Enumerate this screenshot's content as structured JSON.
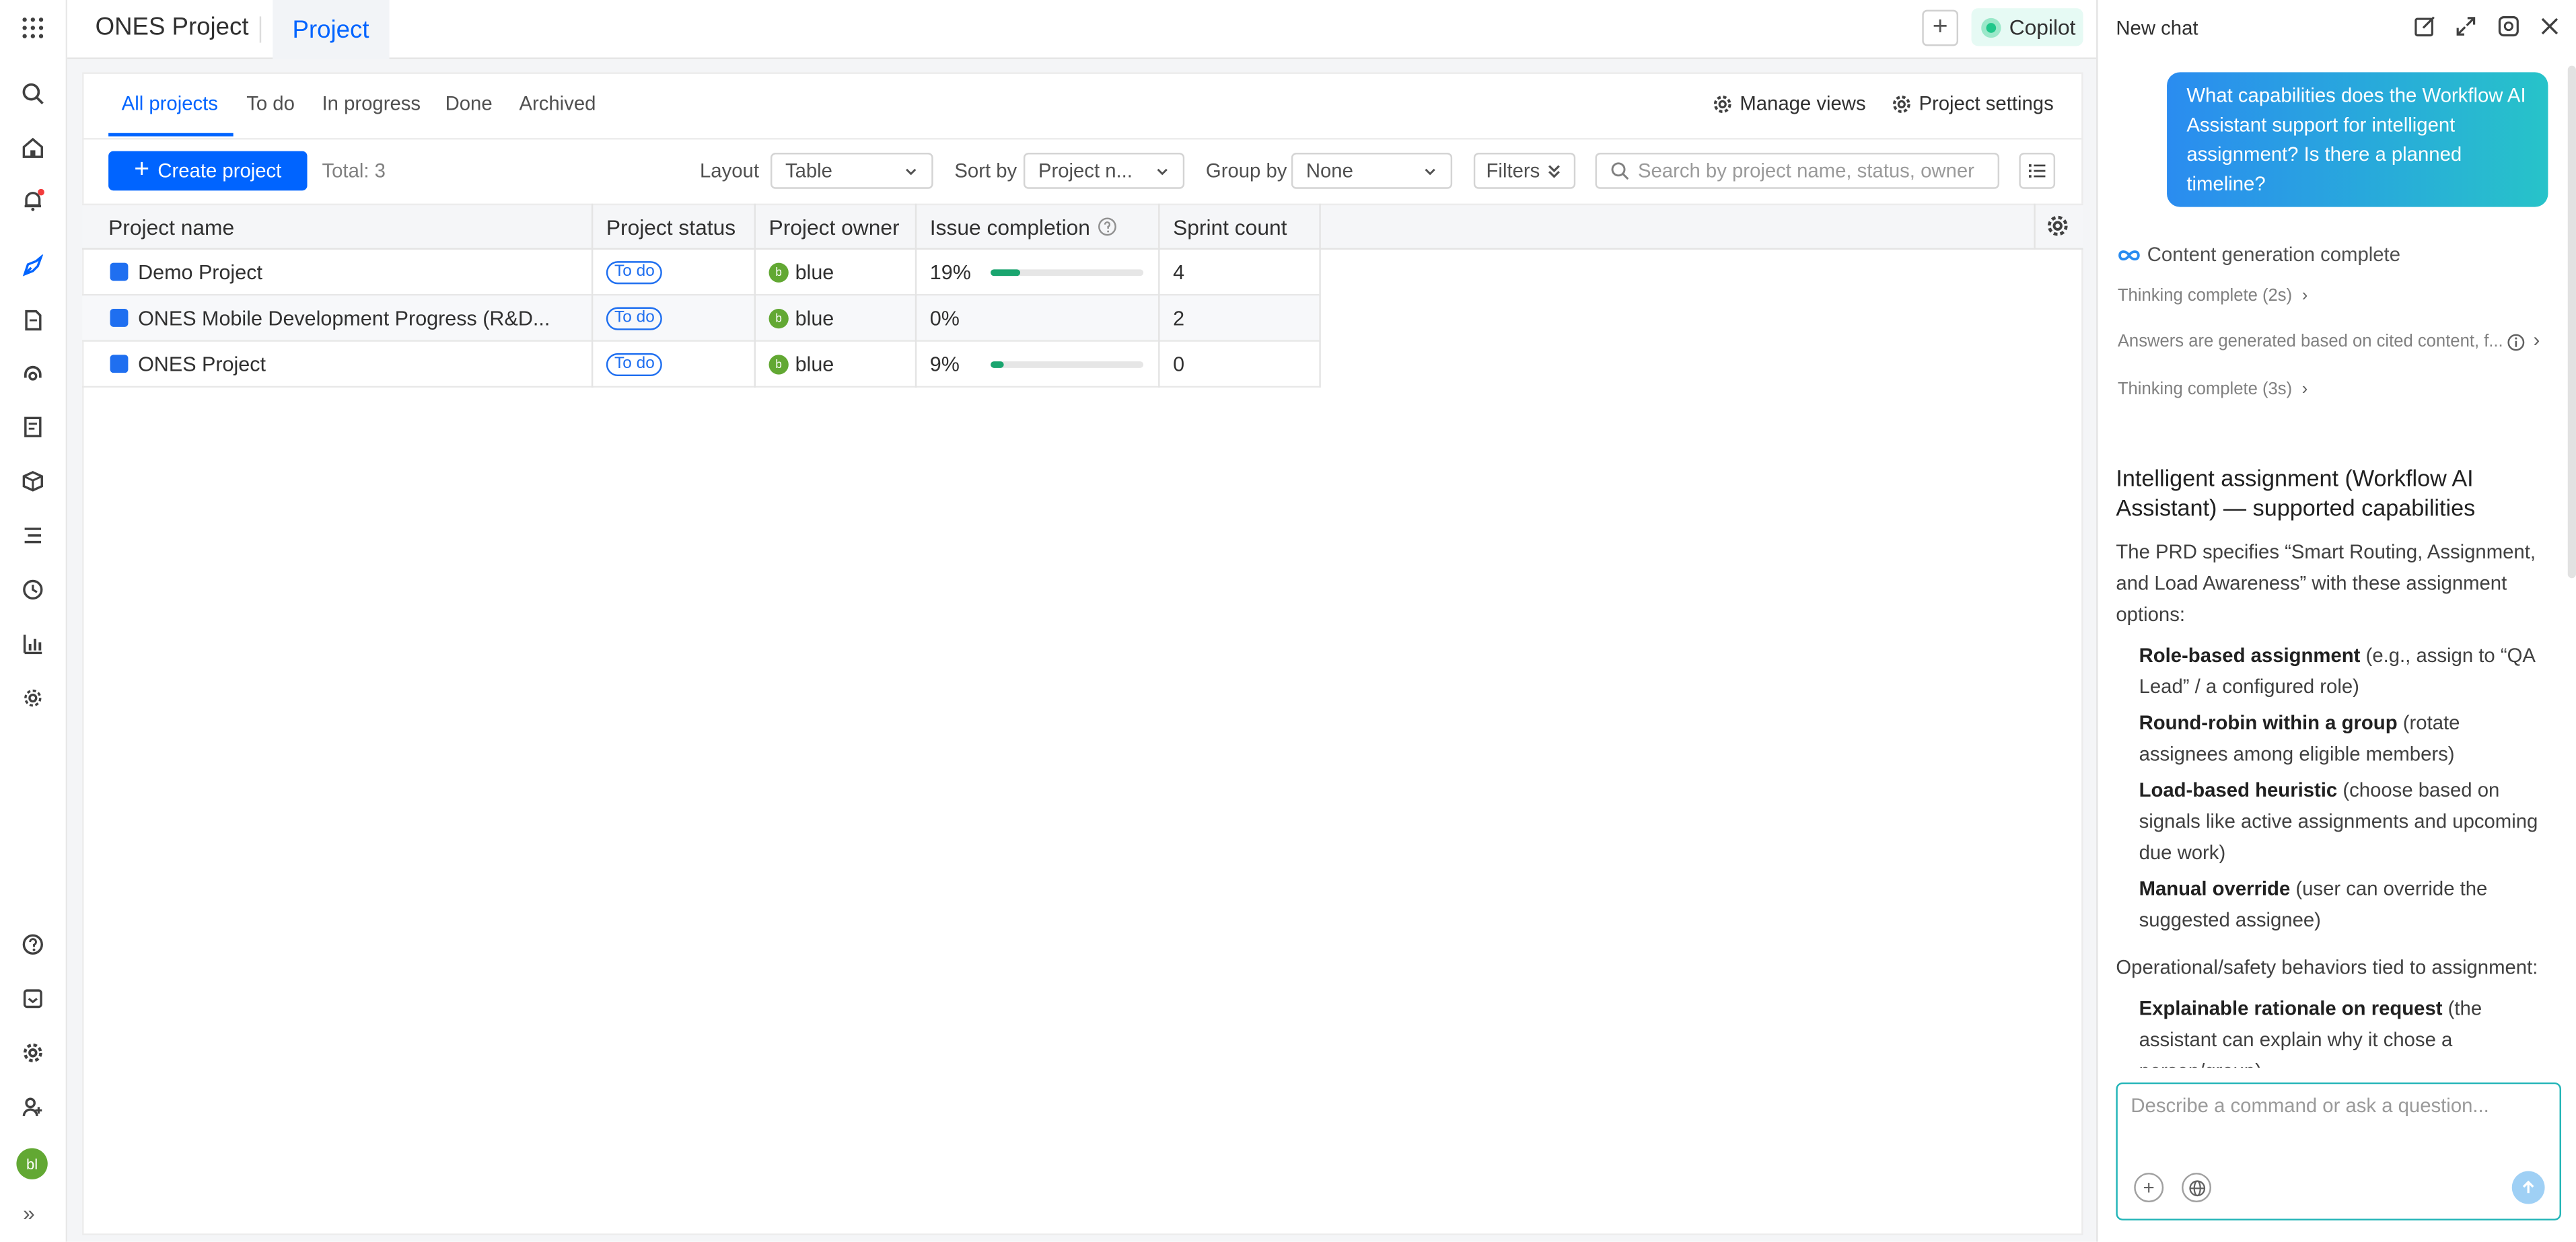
{
  "topbar": {
    "app_title": "ONES Project",
    "tab_project": "Project",
    "add_symbol": "+",
    "copilot_label": "Copilot"
  },
  "views": {
    "tabs": [
      "All projects",
      "To do",
      "In progress",
      "Done",
      "Archived"
    ],
    "manage_views": "Manage views",
    "project_settings": "Project settings"
  },
  "toolbar": {
    "create_label": "Create project",
    "create_symbol": "+",
    "total": "Total: 3",
    "layout_label": "Layout",
    "layout_value": "Table",
    "sort_label": "Sort by",
    "sort_value": "Project n...",
    "group_label": "Group by",
    "group_value": "None",
    "filters_label": "Filters",
    "search_placeholder": "Search by project name, status, owner"
  },
  "table": {
    "columns": [
      "Project name",
      "Project status",
      "Project owner",
      "Issue completion",
      "Sprint count"
    ],
    "rows": [
      {
        "name": "Demo Project",
        "status": "To do",
        "owner": "blue",
        "owner_initial": "b",
        "completion": "19%",
        "progress": 0.19,
        "sprints": "4"
      },
      {
        "name": "ONES Mobile Development Progress (R&D...",
        "status": "To do",
        "owner": "blue",
        "owner_initial": "b",
        "completion": "0%",
        "progress": 0,
        "sprints": "2"
      },
      {
        "name": "ONES Project",
        "status": "To do",
        "owner": "blue",
        "owner_initial": "b",
        "completion": "9%",
        "progress": 0.09,
        "sprints": "0"
      }
    ]
  },
  "rail": {
    "icons": [
      "apps-grid-icon",
      "search-icon",
      "home-icon",
      "notification-bell-icon",
      "project-icon",
      "document-icon",
      "headset-icon",
      "wiki-icon",
      "package-icon",
      "testcase-icon",
      "clock-icon",
      "analytics-icon",
      "settings-cog-icon",
      "help-icon",
      "inbox-icon",
      "gear-icon",
      "add-member-icon"
    ],
    "avatar": "bl",
    "expand": "»"
  },
  "chat": {
    "title": "New chat",
    "user_message": "What capabilities does the Workflow AI Assistant support for intelligent assignment? Is there a planned timeline?",
    "generation_status": "Content generation complete",
    "thinking_1": "Thinking complete (2s)",
    "cited_note": "Answers are generated based on cited content, f...",
    "thinking_2": "Thinking complete (3s)",
    "heading": "Intelligent assignment (Workflow AI Assistant) — supported capabilities",
    "intro": "The PRD specifies “Smart Routing, Assignment, and Load Awareness” with these assignment options:",
    "items": [
      {
        "title": "Role-based assignment",
        "desc": " (e.g., assign to “QA Lead” / a configured role)"
      },
      {
        "title": "Round-robin within a group",
        "desc": " (rotate assignees among eligible members)"
      },
      {
        "title": "Load-based heuristic",
        "desc": " (choose based on signals like active assignments and upcoming due work)"
      },
      {
        "title": "Manual override",
        "desc": " (user can override the suggested assignee)"
      }
    ],
    "ops_heading": "Operational/safety behaviors tied to assignment:",
    "ops_items": [
      {
        "title": "Explainable rationale on request",
        "desc": " (the assistant can explain why it chose a person/group)"
      }
    ],
    "input_placeholder": "Describe a command or ask a question...",
    "plus_symbol": "+"
  },
  "colors": {
    "accent": "#0064ff",
    "progress": "#1aa56f",
    "copilot": "#1fc78a",
    "chat_gradient_start": "#2a8cf0",
    "chat_gradient_end": "#27c3c9"
  }
}
